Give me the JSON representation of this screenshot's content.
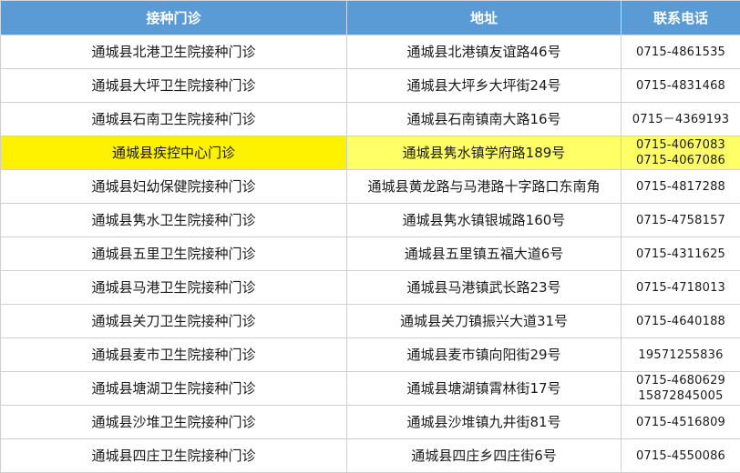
{
  "headers": [
    "接种门诊",
    "地址",
    "联系电话"
  ],
  "rows": [
    {
      "name": "通城县北港卫生院接种门诊",
      "address": "通城县北港镇友谊路46号",
      "phone": [
        "0715-4861535"
      ],
      "highlight": false
    },
    {
      "name": "通城县大坪卫生院接种门诊",
      "address": "通城县大坪乡大坪街24号",
      "phone": [
        "0715-4831468"
      ],
      "highlight": false
    },
    {
      "name": "通城县石南卫生院接种门诊",
      "address": "通城县石南镇南大路16号",
      "phone": [
        "0715－4369193"
      ],
      "highlight": false
    },
    {
      "name": "通城县疾控中心门诊",
      "address": "通城县隽水镇学府路189号",
      "phone": [
        "0715-4067083",
        "0715-4067086"
      ],
      "highlight": true
    },
    {
      "name": "通城县妇幼保健院接种门诊",
      "address": "通城县黄龙路与马港路十字路口东南角",
      "phone": [
        "0715-4817288"
      ],
      "highlight": false
    },
    {
      "name": "通城县隽水卫生院接种门诊",
      "address": "通城县隽水镇银城路160号",
      "phone": [
        "0715-4758157"
      ],
      "highlight": false
    },
    {
      "name": "通城县五里卫生院接种门诊",
      "address": "通城县五里镇五福大道6号",
      "phone": [
        "0715-4311625"
      ],
      "highlight": false
    },
    {
      "name": "通城县马港卫生院接种门诊",
      "address": "通城县马港镇武长路23号",
      "phone": [
        "0715-4718013"
      ],
      "highlight": false
    },
    {
      "name": "通城县关刀卫生院接种门诊",
      "address": "通城县关刀镇振兴大道31号",
      "phone": [
        "0715-4640188"
      ],
      "highlight": false
    },
    {
      "name": "通城县麦市卫生院接种门诊",
      "address": "通城县麦市镇向阳街29号",
      "phone": [
        "19571255836"
      ],
      "highlight": false
    },
    {
      "name": "通城县塘湖卫生院接种门诊",
      "address": "通城县塘湖镇霄林街17号",
      "phone": [
        "0715-4680629",
        "15872845005"
      ],
      "highlight": false
    },
    {
      "name": "通城县沙堆卫生院接种门诊",
      "address": "通城县沙堆镇九井街81号",
      "phone": [
        "0715-4516809"
      ],
      "highlight": false
    },
    {
      "name": "通城县四庄卫生院接种门诊",
      "address": "通城县四庄乡四庄街6号",
      "phone": [
        "0715-4550086"
      ],
      "highlight": false
    }
  ]
}
